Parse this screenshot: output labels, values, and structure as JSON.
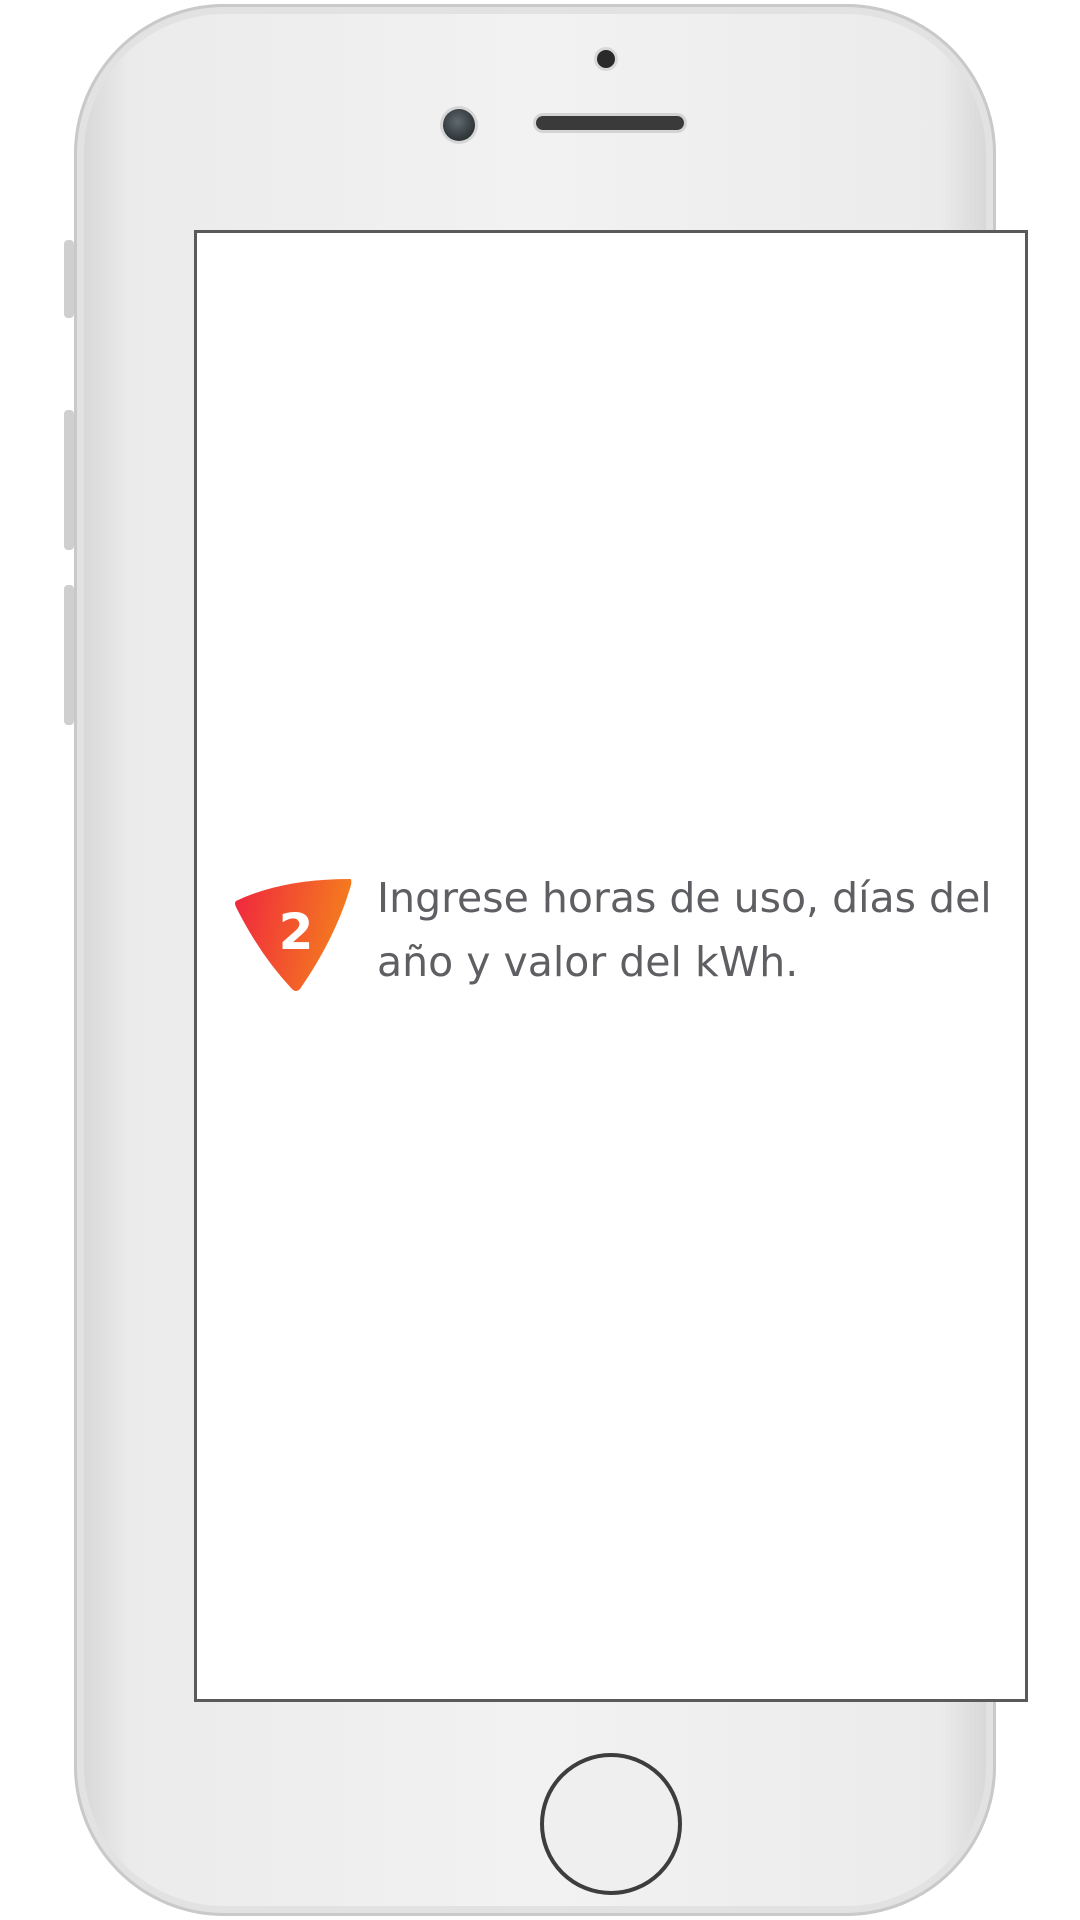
{
  "instruction": {
    "step_number": "2",
    "text": "Ingrese horas de uso, días del año y valor del kWh."
  },
  "colors": {
    "badge_gradient_start": "#f0253f",
    "badge_gradient_end": "#f47d1e",
    "instruction_text": "#5f5f63",
    "phone_body": "#f2f2f2"
  },
  "icons": {
    "home_button": "circle-ring",
    "badge": "rounded-triangle"
  }
}
